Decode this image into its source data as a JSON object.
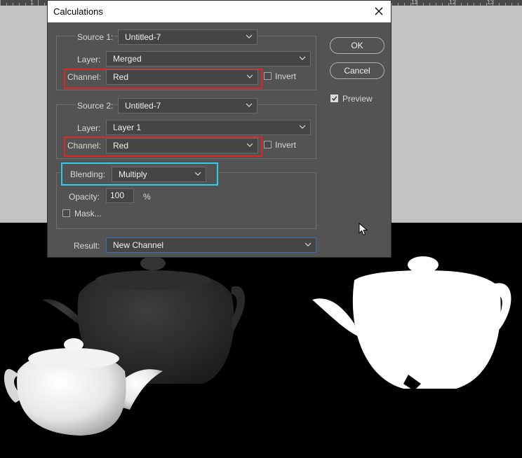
{
  "ruler": {
    "numbers": [
      "1",
      "11",
      "12",
      "13"
    ]
  },
  "dialog": {
    "title": "Calculations",
    "source1": {
      "label": "Source 1:",
      "value": "Untitled-7"
    },
    "layer1": {
      "label": "Layer:",
      "value": "Merged"
    },
    "channel1": {
      "label": "Channel:",
      "value": "Red"
    },
    "invert1": {
      "label": "Invert",
      "checked": false
    },
    "source2": {
      "label": "Source 2:",
      "value": "Untitled-7"
    },
    "layer2": {
      "label": "Layer:",
      "value": "Layer 1"
    },
    "channel2": {
      "label": "Channel:",
      "value": "Red"
    },
    "invert2": {
      "label": "Invert",
      "checked": false
    },
    "blending": {
      "label": "Blending:",
      "value": "Multiply"
    },
    "opacity": {
      "label": "Opacity:",
      "value": "100",
      "unit": "%"
    },
    "mask": {
      "label": "Mask...",
      "checked": false
    },
    "result": {
      "label": "Result:",
      "value": "New Channel"
    },
    "ok_label": "OK",
    "cancel_label": "Cancel",
    "preview": {
      "label": "Preview",
      "checked": true
    }
  },
  "colors": {
    "dialog_bg": "#535353",
    "highlight_red": "#e02424",
    "highlight_cyan": "#27d0e8",
    "focus_blue": "#3d6fb0"
  }
}
